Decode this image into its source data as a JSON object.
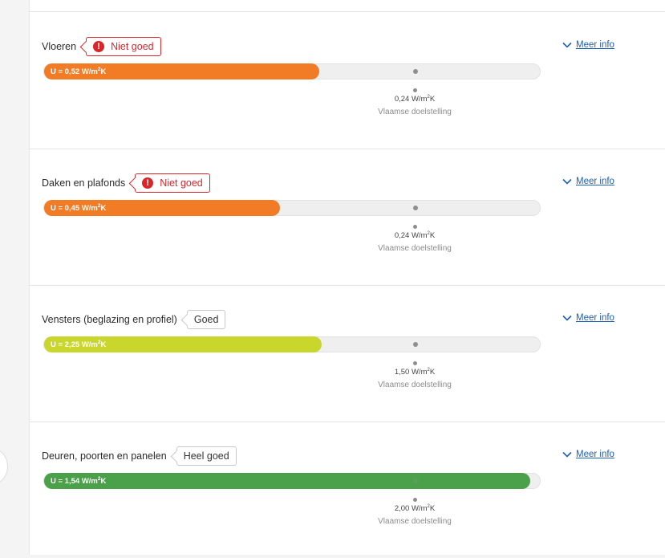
{
  "colors": {
    "bad": "#f27b26",
    "ok": "#c9d62b",
    "very_good": "#4aa14a",
    "warn": "#d9262b",
    "link": "#1d5fb4"
  },
  "sections": [
    {
      "title": "Vloeren",
      "status": {
        "label": "Niet goed",
        "level": "bad",
        "icon": "exclamation-icon"
      },
      "bar": {
        "label": "U = 0,52 W/m²K",
        "value": 0.52,
        "color": "#f27b26"
      },
      "target": {
        "value": "0,24 W/m²K",
        "label": "Vlaamse doelstelling"
      },
      "more": "Meer info"
    },
    {
      "title": "Daken en plafonds",
      "status": {
        "label": "Niet goed",
        "level": "bad",
        "icon": "exclamation-icon"
      },
      "bar": {
        "label": "U = 0,45 W/m²K",
        "value": 0.45,
        "color": "#f27b26"
      },
      "target": {
        "value": "0,24 W/m²K",
        "label": "Vlaamse doelstelling"
      },
      "more": "Meer info"
    },
    {
      "title": "Vensters (beglazing en profiel)",
      "status": {
        "label": "Goed",
        "level": "ok",
        "icon": ""
      },
      "bar": {
        "label": "U = 2,25 W/m²K",
        "value": 2.25,
        "color": "#c9d62b"
      },
      "target": {
        "value": "1,50 W/m²K",
        "label": "Vlaamse doelstelling"
      },
      "more": "Meer info"
    },
    {
      "title": "Deuren, poorten en panelen",
      "status": {
        "label": "Heel goed",
        "level": "very_good",
        "icon": ""
      },
      "bar": {
        "label": "U = 1,54 W/m²K",
        "value": 1.54,
        "color": "#4aa14a"
      },
      "target": {
        "value": "2,00 W/m²K",
        "label": "Vlaamse doelstelling"
      },
      "more": "Meer info"
    }
  ]
}
